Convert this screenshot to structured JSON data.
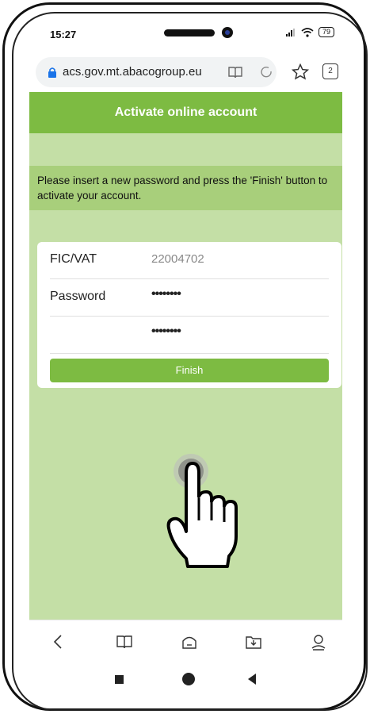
{
  "status": {
    "time": "15:27",
    "battery": "79"
  },
  "browser": {
    "url": "acs.gov.mt.abacogroup.eu",
    "tab_count": "2"
  },
  "page": {
    "header": "Activate online account",
    "instructions": "Please insert a new password and press the 'Finish' button to activate your account.",
    "form": {
      "fic_label": "FIC/VAT",
      "fic_value": "22004702",
      "password_label": "Password",
      "password_mask": "••••••••",
      "confirm_label": "",
      "confirm_mask": "••••••••",
      "finish_label": "Finish"
    }
  },
  "colors": {
    "header": "#7dbb42",
    "page_bg": "#c4dfa6",
    "info_bg": "#a8cf7b"
  }
}
